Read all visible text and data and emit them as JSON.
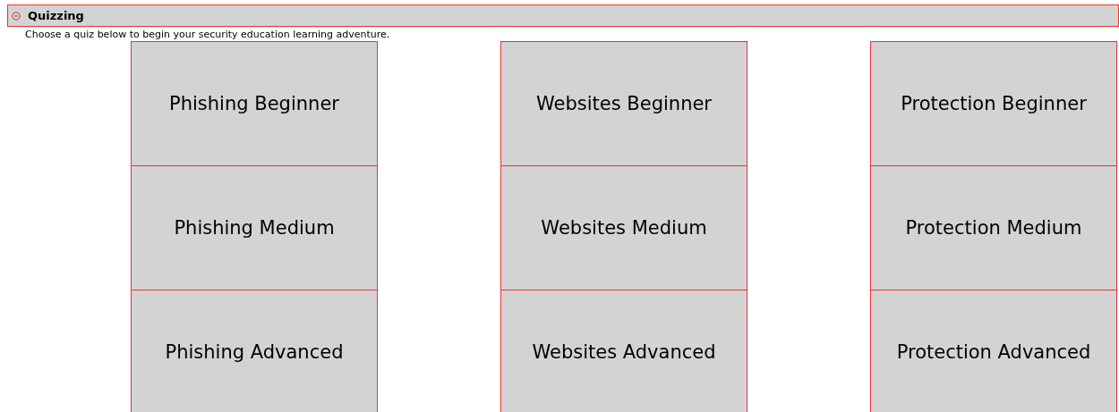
{
  "section": {
    "title": "Quizzing",
    "expanded": true,
    "intro": "Choose a quiz below to begin your security education learning adventure."
  },
  "quiz_columns": [
    {
      "quizzes": [
        "Phishing Beginner",
        "Phishing Medium",
        "Phishing Advanced"
      ]
    },
    {
      "quizzes": [
        "Websites Beginner",
        "Websites Medium",
        "Websites Advanced"
      ]
    },
    {
      "quizzes": [
        "Protection Beginner",
        "Protection Medium",
        "Protection Advanced"
      ]
    }
  ]
}
